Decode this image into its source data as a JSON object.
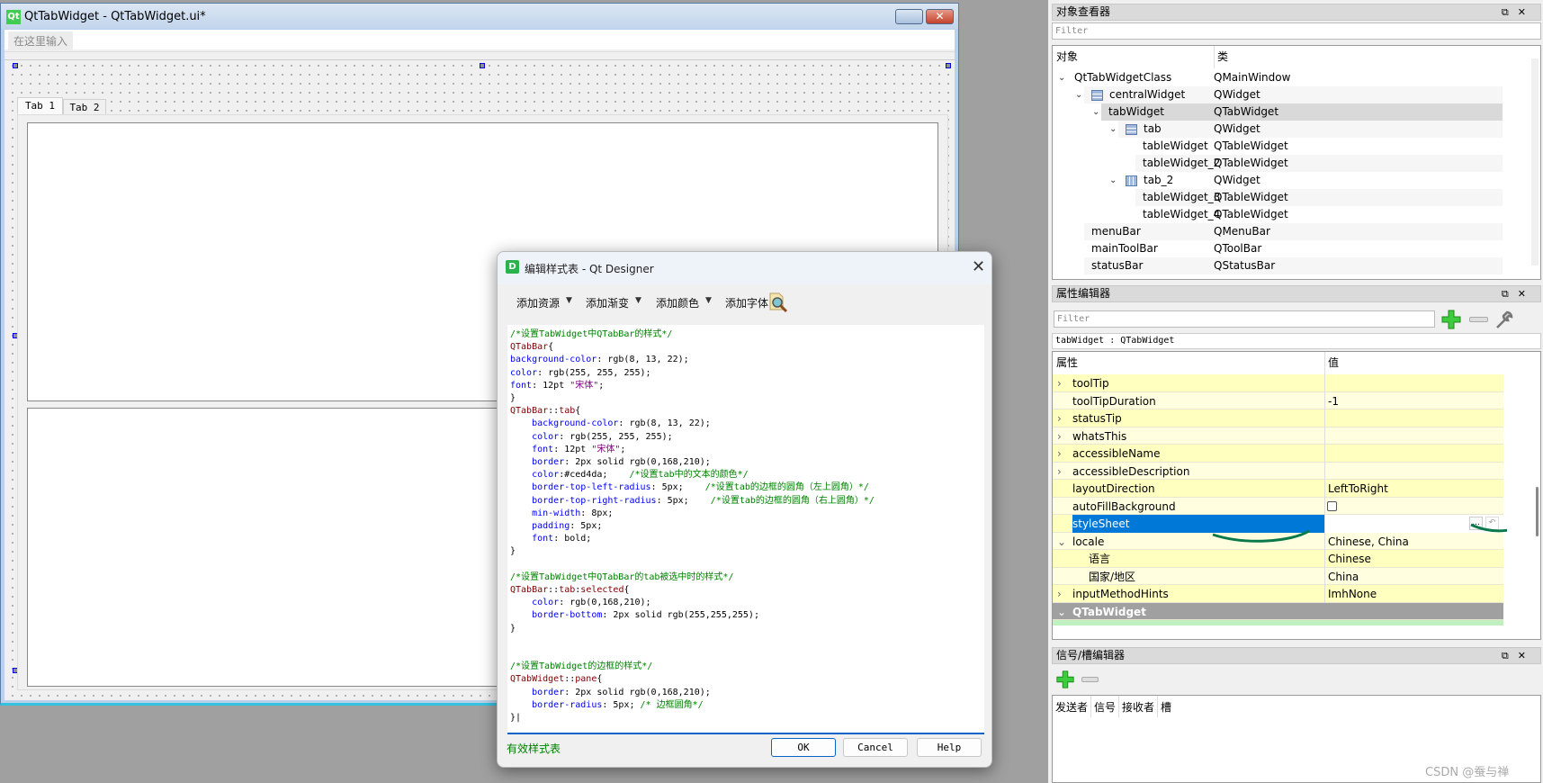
{
  "designer": {
    "title": "QtTabWidget - QtTabWidget.ui*",
    "menu_hint": "在这里输入",
    "tabs": [
      "Tab 1",
      "Tab 2"
    ],
    "close_symbol": "✕"
  },
  "dialog": {
    "title": "编辑样式表 - Qt Designer",
    "icon_letter": "D",
    "close_symbol": "✕",
    "toolbar": [
      "添加资源",
      "添加渐变",
      "添加颜色",
      "添加字体"
    ],
    "dropdown_symbol": "▼",
    "code": [
      [
        [
          "comment",
          "/*设置TabWidget中QTabBar的样式*/"
        ]
      ],
      [
        [
          "sel",
          "QTabBar"
        ],
        [
          "plain",
          "{"
        ]
      ],
      [
        [
          "prop",
          "background-color"
        ],
        [
          "plain",
          ": rgb(8, 13, 22);"
        ]
      ],
      [
        [
          "prop",
          "color"
        ],
        [
          "plain",
          ": rgb(255, 255, 255);"
        ]
      ],
      [
        [
          "prop",
          "font"
        ],
        [
          "plain",
          ": 12pt "
        ],
        [
          "str",
          "\"宋体\""
        ],
        [
          "plain",
          ";"
        ]
      ],
      [
        [
          "plain",
          "}"
        ]
      ],
      [
        [
          "sel",
          "QTabBar"
        ],
        [
          "plain",
          "::"
        ],
        [
          "sel",
          "tab"
        ],
        [
          "plain",
          "{"
        ]
      ],
      [
        [
          "plain",
          "    "
        ],
        [
          "prop",
          "background-color"
        ],
        [
          "plain",
          ": rgb(8, 13, 22);"
        ]
      ],
      [
        [
          "plain",
          "    "
        ],
        [
          "prop",
          "color"
        ],
        [
          "plain",
          ": rgb(255, 255, 255);"
        ]
      ],
      [
        [
          "plain",
          "    "
        ],
        [
          "prop",
          "font"
        ],
        [
          "plain",
          ": 12pt "
        ],
        [
          "str",
          "\"宋体\""
        ],
        [
          "plain",
          ";"
        ]
      ],
      [
        [
          "plain",
          "    "
        ],
        [
          "prop",
          "border"
        ],
        [
          "plain",
          ": 2px solid rgb(0,168,210);"
        ]
      ],
      [
        [
          "plain",
          "    "
        ],
        [
          "prop",
          "color"
        ],
        [
          "plain",
          ":#ced4da;    "
        ],
        [
          "comment",
          "/*设置tab中的文本的颜色*/"
        ]
      ],
      [
        [
          "plain",
          "    "
        ],
        [
          "prop",
          "border-top-left-radius"
        ],
        [
          "plain",
          ": 5px;    "
        ],
        [
          "comment",
          "/*设置tab的边框的圆角（左上圆角）*/"
        ]
      ],
      [
        [
          "plain",
          "    "
        ],
        [
          "prop",
          "border-top-right-radius"
        ],
        [
          "plain",
          ": 5px;    "
        ],
        [
          "comment",
          "/*设置tab的边框的圆角（右上圆角）*/"
        ]
      ],
      [
        [
          "plain",
          "    "
        ],
        [
          "prop",
          "min-width"
        ],
        [
          "plain",
          ": 8px;"
        ]
      ],
      [
        [
          "plain",
          "    "
        ],
        [
          "prop",
          "padding"
        ],
        [
          "plain",
          ": 5px;"
        ]
      ],
      [
        [
          "plain",
          "    "
        ],
        [
          "prop",
          "font"
        ],
        [
          "plain",
          ": bold;"
        ]
      ],
      [
        [
          "plain",
          "}"
        ]
      ],
      [
        [
          "plain",
          " "
        ]
      ],
      [
        [
          "comment",
          "/*设置TabWidget中QTabBar的tab被选中时的样式*/"
        ]
      ],
      [
        [
          "sel",
          "QTabBar"
        ],
        [
          "plain",
          "::"
        ],
        [
          "sel",
          "tab"
        ],
        [
          "plain",
          ":"
        ],
        [
          "sel",
          "selected"
        ],
        [
          "plain",
          "{"
        ]
      ],
      [
        [
          "plain",
          "    "
        ],
        [
          "prop",
          "color"
        ],
        [
          "plain",
          ": rgb(0,168,210);"
        ]
      ],
      [
        [
          "plain",
          "    "
        ],
        [
          "prop",
          "border-bottom"
        ],
        [
          "plain",
          ": 2px solid rgb(255,255,255);"
        ]
      ],
      [
        [
          "plain",
          "}"
        ]
      ],
      [
        [
          "plain",
          " "
        ]
      ],
      [
        [
          "plain",
          " "
        ]
      ],
      [
        [
          "comment",
          "/*设置TabWidget的边框的样式*/"
        ]
      ],
      [
        [
          "sel",
          "QTabWidget"
        ],
        [
          "plain",
          "::"
        ],
        [
          "sel",
          "pane"
        ],
        [
          "plain",
          "{"
        ]
      ],
      [
        [
          "plain",
          "    "
        ],
        [
          "prop",
          "border"
        ],
        [
          "plain",
          ": 2px solid rgb(0,168,210);"
        ]
      ],
      [
        [
          "plain",
          "    "
        ],
        [
          "prop",
          "border-radius"
        ],
        [
          "plain",
          ": 5px; "
        ],
        [
          "comment",
          "/* 边框圆角*/"
        ]
      ],
      [
        [
          "plain",
          "}|"
        ]
      ]
    ],
    "status": "有效样式表",
    "ok": "OK",
    "cancel": "Cancel",
    "help": "Help"
  },
  "object_inspector": {
    "title": "对象查看器",
    "dock_buttons": "⧉✕",
    "filter_placeholder": "Filter",
    "columns": [
      "对象",
      "类"
    ],
    "rows": [
      {
        "name": "QtTabWidgetClass",
        "cls": "QMainWindow",
        "level": 0,
        "expanded": true,
        "icon": ""
      },
      {
        "name": "centralWidget",
        "cls": "QWidget",
        "level": 1,
        "expanded": true,
        "icon": "layout-vertical-icon"
      },
      {
        "name": "tabWidget",
        "cls": "QTabWidget",
        "level": 2,
        "expanded": true,
        "icon": "",
        "selected": true
      },
      {
        "name": "tab",
        "cls": "QWidget",
        "level": 3,
        "expanded": true,
        "icon": "layout-vertical-icon"
      },
      {
        "name": "tableWidget",
        "cls": "QTableWidget",
        "level": 4,
        "icon": ""
      },
      {
        "name": "tableWidget_2",
        "cls": "QTableWidget",
        "level": 4,
        "icon": ""
      },
      {
        "name": "tab_2",
        "cls": "QWidget",
        "level": 3,
        "expanded": true,
        "icon": "layout-horizontal-icon"
      },
      {
        "name": "tableWidget_3",
        "cls": "QTableWidget",
        "level": 4,
        "icon": ""
      },
      {
        "name": "tableWidget_4",
        "cls": "QTableWidget",
        "level": 4,
        "icon": ""
      },
      {
        "name": "menuBar",
        "cls": "QMenuBar",
        "level": 1,
        "icon": ""
      },
      {
        "name": "mainToolBar",
        "cls": "QToolBar",
        "level": 1,
        "icon": ""
      },
      {
        "name": "statusBar",
        "cls": "QStatusBar",
        "level": 1,
        "icon": ""
      }
    ]
  },
  "property_editor": {
    "title": "属性编辑器",
    "dock_buttons": "⧉✕",
    "filter_placeholder": "Filter",
    "object_label": "tabWidget : QTabWidget",
    "columns": [
      "属性",
      "值"
    ],
    "rows": [
      {
        "name": "toolTip",
        "value": "",
        "expander": "›"
      },
      {
        "name": "toolTipDuration",
        "value": "-1",
        "expander": ""
      },
      {
        "name": "statusTip",
        "value": "",
        "expander": "›"
      },
      {
        "name": "whatsThis",
        "value": "",
        "expander": "›"
      },
      {
        "name": "accessibleName",
        "value": "",
        "expander": "›"
      },
      {
        "name": "accessibleDescription",
        "value": "",
        "expander": "›"
      },
      {
        "name": "layoutDirection",
        "value": "LeftToRight",
        "expander": ""
      },
      {
        "name": "autoFillBackground",
        "value": "",
        "expander": "",
        "checkbox": true,
        "checked": false
      },
      {
        "name": "styleSheet",
        "value": "",
        "expander": "",
        "selected": true
      },
      {
        "name": "locale",
        "value": "Chinese, China",
        "expander": "⌄"
      },
      {
        "name": "语言",
        "value": "Chinese",
        "expander": "",
        "sub": true
      },
      {
        "name": "国家/地区",
        "value": "China",
        "expander": "",
        "sub": true
      },
      {
        "name": "inputMethodHints",
        "value": "ImhNone",
        "expander": "›"
      },
      {
        "name": "QTabWidget",
        "value": "",
        "expander": "⌄",
        "section": true
      }
    ],
    "ellipsis": "...",
    "reset_symbol": "↶"
  },
  "signal_slot_editor": {
    "title": "信号/槽编辑器",
    "dock_buttons": "⧉✕",
    "columns": [
      "发送者",
      "信号",
      "接收者",
      "槽"
    ]
  },
  "watermark": "CSDN @蚕与禅",
  "colors": {
    "accent": "#0078d7",
    "highlight_row": "#ffffc0",
    "section": "#a0a0a0"
  }
}
